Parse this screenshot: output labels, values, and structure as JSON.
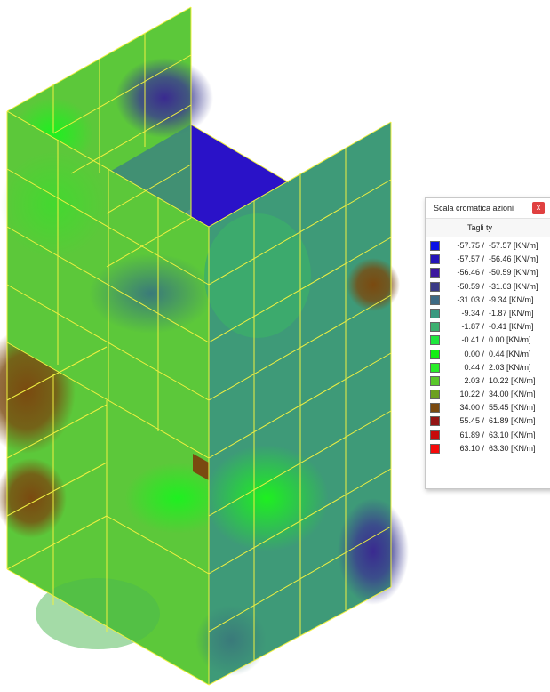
{
  "legend": {
    "title": "Scala cromatica azioni",
    "close_label": "x",
    "header": "Tagli ty",
    "rows": [
      {
        "from": "-57.75 /",
        "to": "-57.57 [KN/m]",
        "color": "#0a10e6"
      },
      {
        "from": "-57.57 /",
        "to": "-56.46 [KN/m]",
        "color": "#2414b8"
      },
      {
        "from": "-56.46 /",
        "to": "-50.59 [KN/m]",
        "color": "#3c189e"
      },
      {
        "from": "-50.59 /",
        "to": "-31.03 [KN/m]",
        "color": "#3a3a86"
      },
      {
        "from": "-31.03 /",
        "to": "-9.34 [KN/m]",
        "color": "#3e6a84"
      },
      {
        "from": "-9.34 /",
        "to": "-1.87 [KN/m]",
        "color": "#3a9a80"
      },
      {
        "from": "-1.87 /",
        "to": "-0.41 [KN/m]",
        "color": "#3cb070"
      },
      {
        "from": "-0.41 /",
        "to": "0.00 [KN/m]",
        "color": "#1ee83e"
      },
      {
        "from": "0.00 /",
        "to": "0.44 [KN/m]",
        "color": "#14f014"
      },
      {
        "from": "0.44 /",
        "to": "2.03 [KN/m]",
        "color": "#28ee28"
      },
      {
        "from": "2.03 /",
        "to": "10.22 [KN/m]",
        "color": "#5ac82a"
      },
      {
        "from": "10.22 /",
        "to": "34.00 [KN/m]",
        "color": "#6ca020"
      },
      {
        "from": "34.00 /",
        "to": "55.45 [KN/m]",
        "color": "#7a4a10"
      },
      {
        "from": "55.45 /",
        "to": "61.89 [KN/m]",
        "color": "#941414"
      },
      {
        "from": "61.89 /",
        "to": "63.10 [KN/m]",
        "color": "#c80a0a"
      },
      {
        "from": "63.10 /",
        "to": "63.30 [KN/m]",
        "color": "#f50a0a"
      }
    ]
  },
  "mesh_colors": {
    "base_green": "#5cc83a",
    "teal": "#3e9a78",
    "blue": "#2a12c8",
    "purple": "#3c2a8a",
    "brown": "#7a4a10",
    "bright_green": "#1ef020",
    "grid_line": "#f0f040"
  }
}
